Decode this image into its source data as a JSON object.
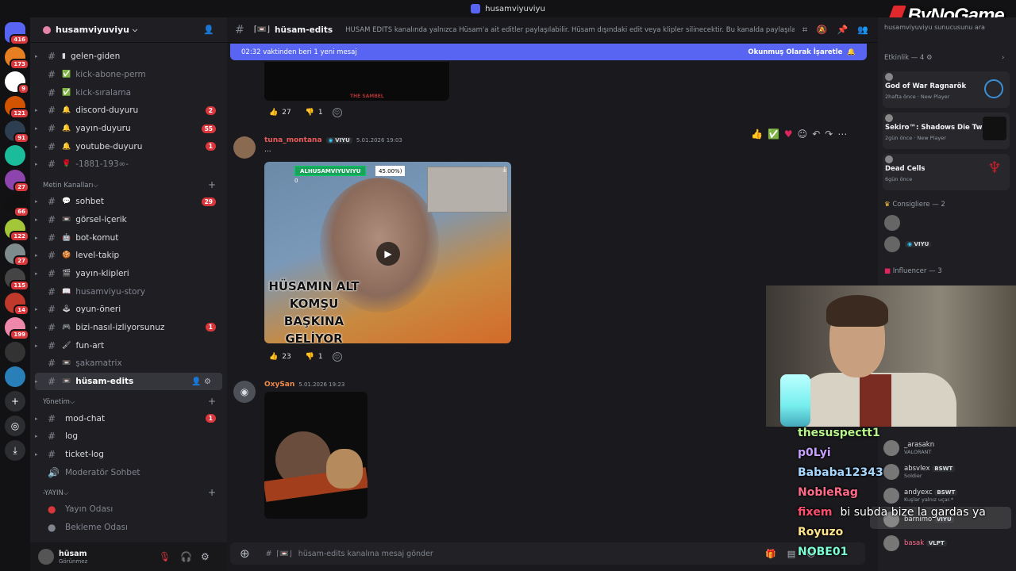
{
  "window_title": "husamviyuviyu",
  "watermark": "ByNoGame",
  "rail_badges": [
    "416",
    "173",
    "9",
    "121",
    "91",
    "",
    "27",
    "66",
    "122",
    "27",
    "115",
    "14",
    "199"
  ],
  "server": {
    "name": "husamviyuviyu"
  },
  "channels": [
    {
      "name": "gelen-giden",
      "icon": "▮",
      "arrow": true,
      "muted": false,
      "count": ""
    },
    {
      "name": "kick-abone-perm",
      "icon": "✅",
      "arrow": false,
      "muted": true,
      "count": ""
    },
    {
      "name": "kick-sıralama",
      "icon": "✅",
      "arrow": false,
      "muted": true,
      "count": ""
    },
    {
      "name": "discord-duyuru",
      "icon": "🔔",
      "arrow": true,
      "muted": false,
      "count": "2"
    },
    {
      "name": "yayın-duyuru",
      "icon": "🔔",
      "arrow": true,
      "muted": false,
      "count": "55"
    },
    {
      "name": "youtube-duyuru",
      "icon": "🔔",
      "arrow": true,
      "muted": false,
      "count": "1"
    },
    {
      "name": "-1881-193∞-",
      "icon": "🌹",
      "arrow": true,
      "muted": true,
      "count": ""
    }
  ],
  "category_text": "Metin Kanalları",
  "text_channels": [
    {
      "name": "sohbet",
      "icon": "💬",
      "arrow": true,
      "muted": false,
      "count": "29"
    },
    {
      "name": "görsel-içerik",
      "icon": "📼",
      "arrow": true,
      "muted": false,
      "count": ""
    },
    {
      "name": "bot-komut",
      "icon": "🤖",
      "arrow": true,
      "muted": false,
      "count": ""
    },
    {
      "name": "level-takip",
      "icon": "🍪",
      "arrow": true,
      "muted": false,
      "count": ""
    },
    {
      "name": "yayın-klipleri",
      "icon": "🎬",
      "arrow": true,
      "muted": false,
      "count": ""
    },
    {
      "name": "husamviyu-story",
      "icon": "📖",
      "arrow": false,
      "muted": true,
      "count": ""
    },
    {
      "name": "oyun-öneri",
      "icon": "🕹",
      "arrow": true,
      "muted": false,
      "count": ""
    },
    {
      "name": "bizi-nasıl-izliyorsunuz",
      "icon": "🎮",
      "arrow": true,
      "muted": false,
      "count": "1"
    },
    {
      "name": "fun-art",
      "icon": "🖌",
      "arrow": true,
      "muted": false,
      "count": ""
    },
    {
      "name": "şakamatrix",
      "icon": "📼",
      "arrow": false,
      "muted": true,
      "count": ""
    }
  ],
  "active_channel": {
    "name": "hüsam-edits",
    "icon": "📼"
  },
  "category_admin": "Yönetim",
  "admin_channels": [
    {
      "name": "mod-chat",
      "count": "1",
      "hash": "#"
    },
    {
      "name": "log",
      "count": "",
      "hash": "#"
    },
    {
      "name": "ticket-log",
      "count": "",
      "hash": "#"
    },
    {
      "name": "Moderatör Sohbet",
      "count": "",
      "hash": "🔊"
    }
  ],
  "category_stream": "-YAYIN",
  "stream_channels": [
    {
      "name": "Yayın Odası"
    },
    {
      "name": "Bekleme Odası"
    }
  ],
  "user": {
    "name": "hüsam",
    "status": "Görünmez"
  },
  "header": {
    "channel_name": "hüsam-edits",
    "topic": "HÜSAM EDİTS kanalında yalnızca Hüsam'a ait editler paylaşılabilir. Hüsam dışındaki edit veya klipler silinecektir. Bu kanalda paylaşılan içerik..."
  },
  "banner": {
    "text": "02:32 vaktinden beri 1 yeni mesaj",
    "action": "Okunmuş Olarak İşaretle"
  },
  "prev_media_label": "THE SAMBEL",
  "reactions_1": {
    "like": "27",
    "dislike": "1"
  },
  "message_1": {
    "author": "tuna_montana",
    "tag": "VIYU",
    "time": "5.01.2026 19:03",
    "text": "...",
    "video_hud_name": "ALHUSAMVIYUVIYU",
    "video_hud_pct": "45.00%)",
    "video_zero": "0",
    "video_caption": "HÜSAMIN ALT KOMŞU BAŞKINA GELİYOR"
  },
  "reactions_2": {
    "like": "23",
    "dislike": "1"
  },
  "message_2": {
    "author": "OxySan",
    "time": "5.01.2026 19:23"
  },
  "composer": {
    "placeholder": "hüsam-edits kanalına mesaj gönder"
  },
  "members": {
    "search": "husamviyuviyu sunucusunu ara",
    "activity_header": "Etkinlik — 4",
    "activities": [
      {
        "title": "God of War Ragnarök",
        "sub": "2hafta önce · New Player",
        "color": "#3a8fd6"
      },
      {
        "title": "Sekiro™: Shadows Die Twice",
        "sub": "2gün önce · New Player",
        "color": "#222"
      },
      {
        "title": "Dead Cells",
        "sub": "6gün önce",
        "color": "#c0202a"
      }
    ],
    "role_consigliere": "Consigliere — 2",
    "role_influencer": "Influencer — 3",
    "consig_tag": "VIYU"
  },
  "stream_chat": [
    {
      "name": "thesuspectt1",
      "color": "#b8f58a",
      "text": ""
    },
    {
      "name": "p0Lyi",
      "color": "#c8a0ff",
      "text": ""
    },
    {
      "name": "Bababa12343",
      "color": "#a8d8ff",
      "text": ""
    },
    {
      "name": "NobleRag",
      "color": "#ff6b8a",
      "text": ""
    },
    {
      "name": "fixem",
      "color": "#ff4d6d",
      "text": "bi subda bize la gardas ya"
    },
    {
      "name": "Royuzo",
      "color": "#ffe38a",
      "text": ""
    },
    {
      "name": "NOBE01",
      "color": "#7dffd4",
      "text": ""
    }
  ],
  "member_list": [
    {
      "name": "_arasakn",
      "sub": "VALORANT",
      "color": "#dbdee1",
      "tag": ""
    },
    {
      "name": "absvlex",
      "sub": "Soldier",
      "color": "#dbdee1",
      "tag": "BSWT"
    },
    {
      "name": "andyexc",
      "sub": "Kuşlar yalnız uçar.*",
      "color": "#dbdee1",
      "tag": "BSWT"
    },
    {
      "name": "barnimo",
      "sub": "",
      "color": "#dbdee1",
      "tag": "VIYU"
    },
    {
      "name": "basak",
      "sub": "",
      "color": "#ff6b8a",
      "tag": "VLPT"
    }
  ]
}
